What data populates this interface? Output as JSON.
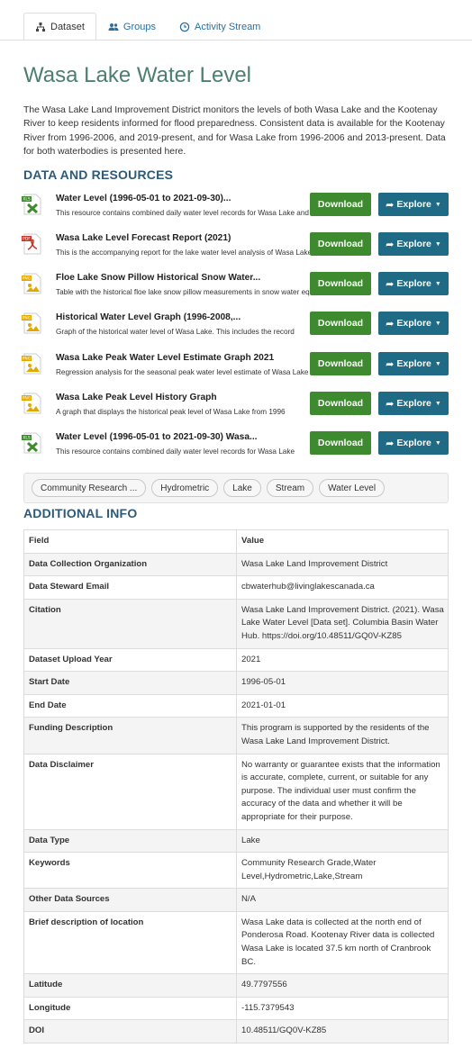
{
  "tabs": [
    {
      "label": "Dataset",
      "icon": "sitemap-icon",
      "active": true
    },
    {
      "label": "Groups",
      "icon": "users-icon",
      "active": false
    },
    {
      "label": "Activity Stream",
      "icon": "clock-icon",
      "active": false
    }
  ],
  "dataset": {
    "title": "Wasa Lake Water Level",
    "description": "The Wasa Lake Land Improvement District monitors the levels of both Wasa Lake and the Kootenay River to keep residents informed for flood preparedness. Consistent data is available for the Kootenay River from 1996-2006, and 2019-present, and for Wasa Lake from 1996-2006 and 2013-present. Data for both waterbodies is presented here."
  },
  "resources_heading": "DATA AND RESOURCES",
  "buttons": {
    "download": "Download",
    "explore": "Explore"
  },
  "resources": [
    {
      "format": "XLS",
      "title": "Water Level (1996-05-01 to 2021-09-30)...",
      "description": "This resource contains combined daily water level records for Wasa Lake and the Kootenay River"
    },
    {
      "format": "PDF",
      "title": "Wasa Lake Level Forecast Report (2021)",
      "description": "This is the accompanying report for the lake water level analysis of Wasa Lake"
    },
    {
      "format": "PNG",
      "title": "Floe Lake Snow Pillow Historical Snow Water...",
      "description": "Table with the historical floe lake snow pillow measurements in snow water equivalent"
    },
    {
      "format": "PNG",
      "title": "Historical Water Level Graph (1996-2008,...",
      "description": "Graph of the historical water level of Wasa Lake. This includes the record"
    },
    {
      "format": "PNG",
      "title": "Wasa Lake Peak Water Level Estimate Graph 2021",
      "description": "Regression analysis for the seasonal peak water level estimate of Wasa Lake"
    },
    {
      "format": "PNG",
      "title": "Wasa Lake Peak Level History Graph",
      "description": "A graph that displays the historical peak level of Wasa Lake from 1996"
    },
    {
      "format": "XLS",
      "title": "Water Level (1996-05-01 to 2021-09-30) Wasa...",
      "description": "This resource contains combined daily water level records for Wasa Lake"
    }
  ],
  "tags": [
    "Community Research ...",
    "Hydrometric",
    "Lake",
    "Stream",
    "Water Level"
  ],
  "additional_heading": "ADDITIONAL INFO",
  "info_table": {
    "headers": [
      "Field",
      "Value"
    ],
    "rows": [
      {
        "field": "Data Collection Organization",
        "value": "Wasa Lake Land Improvement District"
      },
      {
        "field": "Data Steward Email",
        "value": "cbwaterhub@livinglakescanada.ca"
      },
      {
        "field": "Citation",
        "value": "Wasa Lake Land Improvement District. (2021). Wasa Lake Water Level [Data set]. Columbia Basin Water Hub. https://doi.org/10.48511/GQ0V-KZ85"
      },
      {
        "field": "Dataset Upload Year",
        "value": "2021"
      },
      {
        "field": "Start Date",
        "value": "1996-05-01"
      },
      {
        "field": "End Date",
        "value": "2021-01-01"
      },
      {
        "field": "Funding Description",
        "value": "This program is supported by the residents of the Wasa Lake Land Improvement District."
      },
      {
        "field": "Data Disclaimer",
        "value": "No warranty or guarantee exists that the information is accurate, complete, current, or suitable for any purpose. The individual user must confirm the accuracy of the data and whether it will be appropriate for their purpose."
      },
      {
        "field": "Data Type",
        "value": "Lake"
      },
      {
        "field": "Keywords",
        "value": "Community Research Grade,Water Level,Hydrometric,Lake,Stream"
      },
      {
        "field": "Other Data Sources",
        "value": "N/A"
      },
      {
        "field": "Brief description of location",
        "value": "Wasa Lake data is collected at the north end of Ponderosa Road. Kootenay River data is collected Wasa Lake is located 37.5 km north of Cranbrook BC."
      },
      {
        "field": "Latitude",
        "value": "49.7797556"
      },
      {
        "field": "Longitude",
        "value": "-115.7379543"
      },
      {
        "field": "DOI",
        "value": "10.48511/GQ0V-KZ85"
      }
    ]
  },
  "colors": {
    "download": "#3e8b2f",
    "explore": "#1f6b85",
    "title": "#4b7f70",
    "heading": "#2e5a7a",
    "link": "#2a6f9f"
  }
}
